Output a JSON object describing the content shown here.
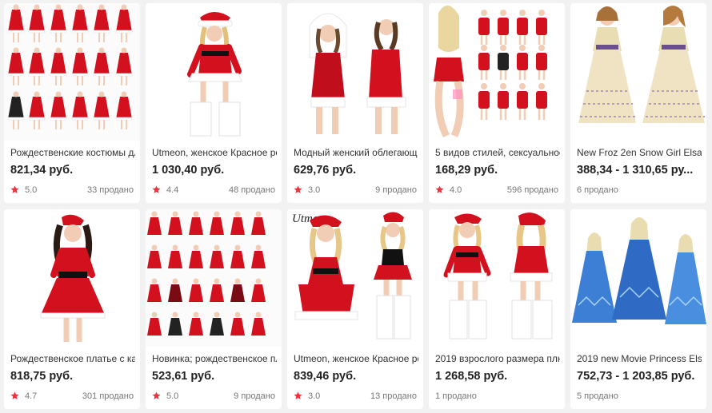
{
  "colors": {
    "star": "#e8343d",
    "price": "#222222",
    "muted": "#777777",
    "santa_red": "#d3101d"
  },
  "star_icon": "star-icon",
  "products": [
    {
      "title": "Рождественские костюмы дл",
      "price": "821,34 руб.",
      "rating": "5.0",
      "sold": "33 продано",
      "image": "santa-collage"
    },
    {
      "title": "Utmeon, женское Красное ро",
      "price": "1 030,40 руб.",
      "rating": "4.4",
      "sold": "48 продано",
      "image": "santa-dress"
    },
    {
      "title": "Модный женский облегающ",
      "price": "629,76 руб.",
      "rating": "3.0",
      "sold": "9 продано",
      "image": "santa-bodysuit"
    },
    {
      "title": "5 видов стилей, сексуальное",
      "price": "168,29 руб.",
      "rating": "4.0",
      "sold": "596 продано",
      "image": "lingerie-collage"
    },
    {
      "title": "New Froz 2en Snow Girl Elsa",
      "price": "388,34 - 1 310,65 ру...",
      "rating": "",
      "sold": "6 продано",
      "image": "anna-dress"
    },
    {
      "title": "Рождественское платье с кап",
      "price": "818,75 руб.",
      "rating": "4.7",
      "sold": "301 продано",
      "image": "santa-hood-dress"
    },
    {
      "title": "Новинка; рождественское пл",
      "price": "523,61 руб.",
      "rating": "5.0",
      "sold": "9 продано",
      "image": "santa-collage-2"
    },
    {
      "title": "Utmeon, женское Красное ро",
      "price": "839,46 руб.",
      "rating": "3.0",
      "sold": "13 продано",
      "image": "utmeon-santa",
      "brand_mark": "Utmeon"
    },
    {
      "title": "2019 взрослого размера плю",
      "price": "1 268,58 руб.",
      "rating": "",
      "sold": "1 продано",
      "image": "santa-front-back"
    },
    {
      "title": "2019 new Movie Princess Els",
      "price": "752,73 - 1 203,85 руб.",
      "rating": "",
      "sold": "5 продано",
      "image": "elsa-dresses"
    }
  ]
}
